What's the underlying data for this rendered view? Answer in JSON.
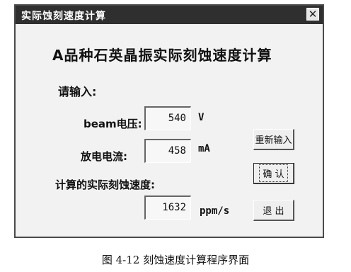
{
  "window": {
    "title": "实际蚀刻速度计算",
    "close_symbol": "✕"
  },
  "main": {
    "heading": "A品种石英晶振实际刻蚀速度计算",
    "prompt": "请输入:"
  },
  "inputs": {
    "beam_voltage": {
      "label": "beam电压:",
      "value": "540",
      "unit": "V"
    },
    "discharge_current": {
      "label": "放电电流:",
      "value": "458",
      "unit": "mA"
    }
  },
  "result": {
    "label": "计算的实际刻蚀速度:",
    "value": "1632",
    "unit": "ppm/s"
  },
  "buttons": {
    "reset": "重新输入",
    "confirm": "确 认",
    "exit": "退 出"
  },
  "caption": "图 4-12 刻蚀速度计算程序界面"
}
